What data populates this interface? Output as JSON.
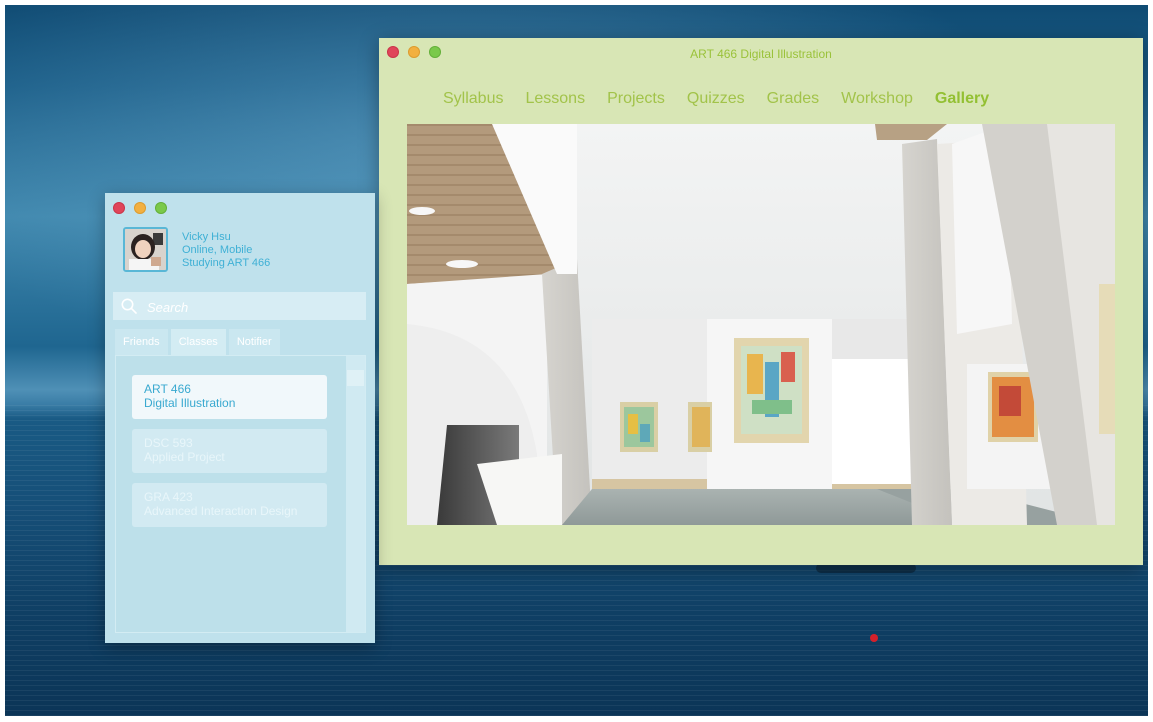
{
  "course": {
    "title": "ART 466 Digital Illustration",
    "tabs": [
      {
        "label": "Syllabus"
      },
      {
        "label": "Lessons"
      },
      {
        "label": "Projects"
      },
      {
        "label": "Quizzes"
      },
      {
        "label": "Grades"
      },
      {
        "label": "Workshop"
      },
      {
        "label": "Gallery",
        "active": true
      }
    ],
    "active_tab": "Gallery",
    "accent_color": "#9ac23a",
    "background_color": "#d8e6b5"
  },
  "messenger": {
    "profile": {
      "name": "Vicky Hsu",
      "status": "Online, Mobile",
      "activity": "Studying ART 466"
    },
    "search": {
      "placeholder": "Search",
      "icon": "search-icon"
    },
    "tabs": [
      {
        "label": "Friends"
      },
      {
        "label": "Classes",
        "active": true
      },
      {
        "label": "Notifier"
      }
    ],
    "classes": [
      {
        "code": "ART 466",
        "name": "Digital Illustration",
        "active": true
      },
      {
        "code": "DSC 593",
        "name": "Applied Project"
      },
      {
        "code": "GRA 423",
        "name": "Advanced Interaction Design"
      }
    ],
    "accent_color": "#3fb0d5",
    "background_color": "#bfe1ec"
  },
  "window_controls": [
    "close",
    "minimize",
    "maximize"
  ]
}
